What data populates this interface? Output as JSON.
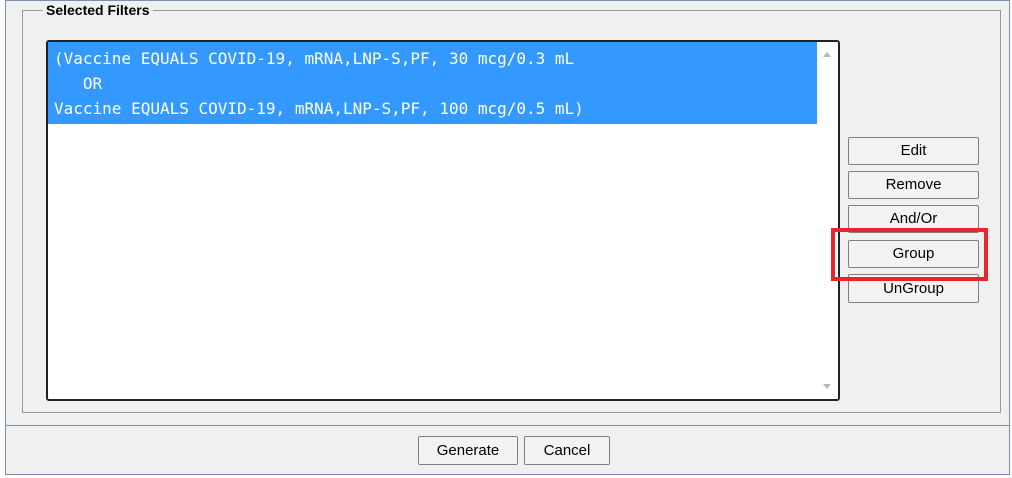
{
  "selected_filters": {
    "legend": "Selected Filters",
    "lines": [
      "(Vaccine EQUALS COVID-19, mRNA,LNP-S,PF, 30 mcg/0.3 mL",
      "   OR",
      "Vaccine EQUALS COVID-19, mRNA,LNP-S,PF, 100 mcg/0.5 mL)"
    ]
  },
  "side_buttons": {
    "edit": "Edit",
    "remove": "Remove",
    "and_or": "And/Or",
    "group": "Group",
    "ungroup": "UnGroup"
  },
  "footer_buttons": {
    "generate": "Generate",
    "cancel": "Cancel"
  },
  "colors": {
    "selection": "#3399ff",
    "highlight": "#e8242c"
  }
}
